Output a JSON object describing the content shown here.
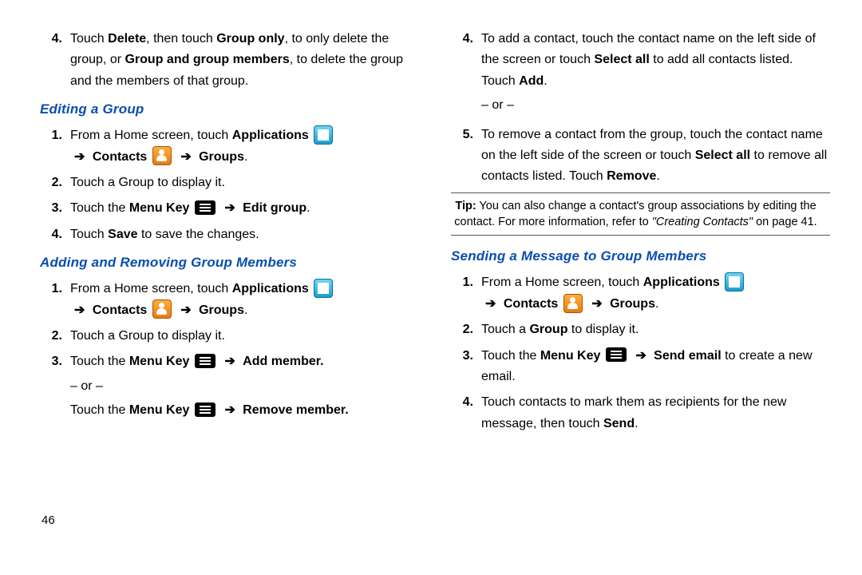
{
  "page_number": "46",
  "arrow": "➔",
  "left": {
    "step4": {
      "num": "4.",
      "pre": "Touch ",
      "b1": "Delete",
      "mid1": ", then touch ",
      "b2": "Group only",
      "mid2": ", to only delete the group, or ",
      "b3": "Group and group members",
      "post": ", to delete the group and the members of that group."
    },
    "h1": "Editing a Group",
    "edit": {
      "s1": {
        "num": "1.",
        "pre": "From a Home screen, touch ",
        "b1": "Applications"
      },
      "s1b": {
        "b1": "Contacts",
        "b2": "Groups",
        "period": "."
      },
      "s2": {
        "num": "2.",
        "text": "Touch a Group to display it."
      },
      "s3": {
        "num": "3.",
        "pre": "Touch the ",
        "b1": "Menu Key",
        "b2": "Edit group",
        "period": "."
      },
      "s4": {
        "num": "4.",
        "pre": "Touch ",
        "b1": "Save",
        "post": " to save the changes."
      }
    },
    "h2": "Adding and Removing Group Members",
    "add": {
      "s1": {
        "num": "1.",
        "pre": "From a Home screen, touch ",
        "b1": "Applications"
      },
      "s1b": {
        "b1": "Contacts",
        "b2": "Groups",
        "period": "."
      },
      "s2": {
        "num": "2.",
        "text": "Touch a Group to display it."
      },
      "s3": {
        "num": "3.",
        "pre": "Touch the ",
        "b1": "Menu Key",
        "b2": "Add member."
      },
      "or": "– or –",
      "s3b": {
        "pre": "Touch the ",
        "b1": "Menu Key",
        "b2": "Remove member."
      }
    }
  },
  "right": {
    "s4": {
      "num": "4.",
      "pre": "To add a contact, touch the contact name on the left side of the screen or touch ",
      "b1": "Select all",
      "mid": " to add all contacts listed. Touch ",
      "b2": "Add",
      "period": "."
    },
    "or": "– or –",
    "s5": {
      "num": "5.",
      "pre": "To remove a contact from the group, touch the contact name on the left side of the screen or touch ",
      "b1": "Select all",
      "mid": " to remove all contacts listed. Touch ",
      "b2": "Remove",
      "period": "."
    },
    "tip": {
      "label": "Tip:",
      "t1": " You can also change a contact's group associations by editing the contact. For more information, refer to ",
      "it": "\"Creating Contacts\"",
      "t2": "  on page 41."
    },
    "h3": "Sending a Message to Group Members",
    "send": {
      "s1": {
        "num": "1.",
        "pre": "From a Home screen, touch ",
        "b1": "Applications"
      },
      "s1b": {
        "b1": "Contacts",
        "b2": "Groups",
        "period": "."
      },
      "s2": {
        "num": "2.",
        "pre": "Touch a ",
        "b1": "Group",
        "post": " to display it."
      },
      "s3": {
        "num": "3.",
        "pre": "Touch the ",
        "b1": "Menu Key",
        "b2": "Send email",
        "post": " to create a new email."
      },
      "s4": {
        "num": "4.",
        "pre": "Touch contacts to mark them as recipients for the new message, then touch ",
        "b1": "Send",
        "period": "."
      }
    }
  }
}
